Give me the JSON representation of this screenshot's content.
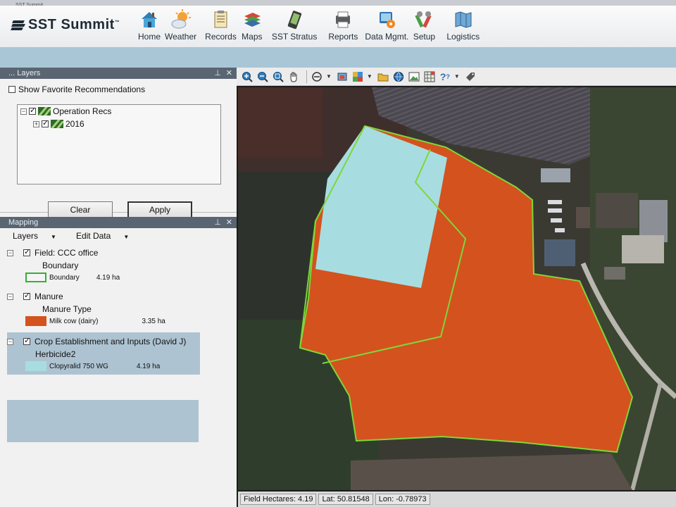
{
  "window": {
    "title": "SST Summit"
  },
  "brand": {
    "name": "SST Summit",
    "tm": "™"
  },
  "nav": [
    {
      "label": "Home",
      "icon": "home-icon"
    },
    {
      "label": "Weather",
      "icon": "weather-icon"
    },
    {
      "label": "Records",
      "icon": "records-icon"
    },
    {
      "label": "Maps",
      "icon": "maps-icon"
    },
    {
      "label": "SST Stratus",
      "icon": "stratus-device-icon"
    },
    {
      "label": "Reports",
      "icon": "reports-icon"
    },
    {
      "label": "Data Mgmt.",
      "icon": "data-management-icon"
    },
    {
      "label": "Setup",
      "icon": "setup-tools-icon"
    },
    {
      "label": "Logistics",
      "icon": "logistics-map-icon"
    }
  ],
  "recommendations_panel": {
    "title": "... Layers",
    "show_favorite_label": "Show Favorite Recommendations",
    "show_favorite_checked": false,
    "tree": [
      {
        "label": "Operation Recs",
        "expanded": true,
        "checked": true
      },
      {
        "label": "2016",
        "expanded": false,
        "checked": true
      }
    ],
    "clear_label": "Clear",
    "apply_label": "Apply"
  },
  "mapping_panel": {
    "title": "Mapping",
    "layers_menu": "Layers",
    "edit_menu": "Edit Data",
    "layers": [
      {
        "name": "Field: CCC office",
        "checked": true,
        "sublabel": "Boundary",
        "legend_label": "Boundary",
        "legend_value": "4.19 ha",
        "swatch": "#f4f4f4",
        "swatch_border": "#34b034"
      },
      {
        "name": "Manure",
        "checked": true,
        "sublabel": "Manure Type",
        "legend_label": "Milk cow (dairy)",
        "legend_value": "3.35 ha",
        "swatch": "#d4521e",
        "swatch_border": "#d4521e"
      },
      {
        "name": "Crop Establishment and Inputs (David J)",
        "checked": true,
        "sublabel": "Herbicide2",
        "legend_label": "Clopyralid 750 WG",
        "legend_value": "4.19 ha",
        "swatch": "#a7dde0",
        "swatch_border": "#a7dde0"
      }
    ]
  },
  "map_toolbar": [
    "zoom-in-icon",
    "zoom-out-icon",
    "zoom-extent-icon",
    "pan-hand-icon",
    "select-icon",
    "layers-icon",
    "map-color-icon",
    "open-folder-icon",
    "globe-icon",
    "export-image-icon",
    "grid-icon",
    "help-icon",
    "tag-icon"
  ],
  "status": {
    "field_hectares": "Field Hectares: 4.19",
    "lat": "Lat: 50.81548",
    "lon": "Lon: -0.78973"
  },
  "colors": {
    "manure": "#d4521e",
    "herbicide": "#a7dde0",
    "boundary": "#7fd63a",
    "banner": "#a8c6d6"
  }
}
